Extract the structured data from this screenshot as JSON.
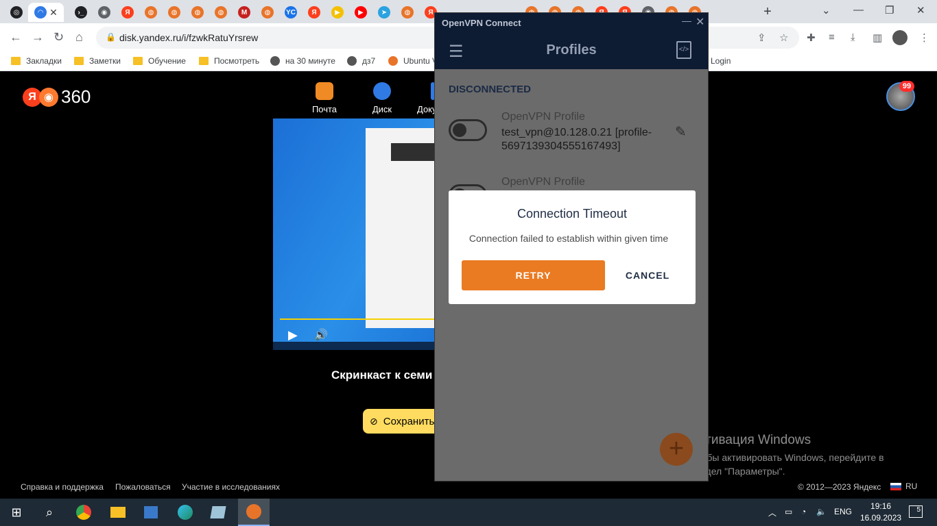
{
  "browser": {
    "tabs": [
      {
        "name": "openai-tab",
        "color": "#202124",
        "glyph": "◎"
      },
      {
        "name": "yandex-disk-tab",
        "color": "#2f7ae5",
        "glyph": "◠",
        "active": true
      },
      {
        "name": "terminal-tab",
        "color": "#202124",
        "glyph": "›_"
      },
      {
        "name": "globe-tab",
        "color": "#5f6368",
        "glyph": "◉"
      },
      {
        "name": "yandex-tab",
        "color": "#fc3f1d",
        "glyph": "Я"
      },
      {
        "name": "openvpn-tab",
        "color": "#e8742a",
        "glyph": "◍"
      },
      {
        "name": "openvpn-tab",
        "color": "#e8742a",
        "glyph": "◍"
      },
      {
        "name": "openvpn-tab",
        "color": "#e8742a",
        "glyph": "◍"
      },
      {
        "name": "openvpn-tab",
        "color": "#e8742a",
        "glyph": "◍"
      },
      {
        "name": "gmail-tab",
        "color": "#c5221f",
        "glyph": "M"
      },
      {
        "name": "openvpn-tab",
        "color": "#e8742a",
        "glyph": "◍"
      },
      {
        "name": "yc-tab",
        "color": "#1a73e8",
        "glyph": "YC"
      },
      {
        "name": "yandex-tab",
        "color": "#fc3f1d",
        "glyph": "Я"
      },
      {
        "name": "yandex-music-tab",
        "color": "#f5c000",
        "glyph": "▶"
      },
      {
        "name": "youtube-tab",
        "color": "#ff0000",
        "glyph": "▶"
      },
      {
        "name": "telegram-tab",
        "color": "#2aa3e0",
        "glyph": "➤"
      },
      {
        "name": "openvpn-tab",
        "color": "#e8742a",
        "glyph": "◍"
      },
      {
        "name": "yandex-tab",
        "color": "#fc3f1d",
        "glyph": "Я"
      }
    ],
    "right_tabs": [
      {
        "name": "openvpn-tab",
        "color": "#e8742a",
        "glyph": "◍"
      },
      {
        "name": "openvpn-tab",
        "color": "#e8742a",
        "glyph": "◍"
      },
      {
        "name": "openvpn-tab",
        "color": "#e8742a",
        "glyph": "◍"
      },
      {
        "name": "yandex-tab",
        "color": "#fc3f1d",
        "glyph": "Я"
      },
      {
        "name": "yandex-tab",
        "color": "#fc3f1d",
        "glyph": "Я"
      },
      {
        "name": "globe-tab",
        "color": "#5f6368",
        "glyph": "◉"
      },
      {
        "name": "openvpn-tab",
        "color": "#e8742a",
        "glyph": "◍"
      },
      {
        "name": "openvpn-tab",
        "color": "#e8742a",
        "glyph": "◍"
      }
    ],
    "new_tab_label": "+",
    "url": "disk.yandex.ru/i/fzwkRatuYrsrew",
    "bookmarks": [
      {
        "label": "Закладки",
        "icon": "folder"
      },
      {
        "label": "Заметки",
        "icon": "folder"
      },
      {
        "label": "Обучение",
        "icon": "folder"
      },
      {
        "label": "Посмотреть",
        "icon": "folder"
      },
      {
        "label": "на 30 минуте",
        "icon": "globe"
      },
      {
        "label": "дз7",
        "icon": "openai"
      },
      {
        "label": "Ubuntu V",
        "icon": "ovpn"
      }
    ],
    "bookmark_right": "Login"
  },
  "yandex": {
    "logo_letter": "Я",
    "logo_number": "360",
    "services": [
      {
        "label": "Почта",
        "color": "#f08a24"
      },
      {
        "label": "Диск",
        "color": "#2f7ae5"
      },
      {
        "label": "Доку",
        "color": "#2f7ae5"
      }
    ],
    "avatar_badge": "99",
    "video_title": "Скринкаст к семи",
    "save_label": "Сохранить",
    "footer": {
      "links": [
        "Справка и поддержка",
        "Пожаловаться",
        "Участие в исследованиях"
      ],
      "copyright": "© 2012—2023 Яндекс",
      "language": "RU"
    }
  },
  "activation": {
    "title": "Активация Windows",
    "text": "Чтобы активировать Windows, перейдите в раздел \"Параметры\"."
  },
  "openvpn": {
    "window_title": "OpenVPN Connect",
    "header_title": "Profiles",
    "status": "DISCONNECTED",
    "profiles": [
      {
        "name": "OpenVPN Profile",
        "description": "test_vpn@10.128.0.21 [profile-5697139304555167493]"
      },
      {
        "name": "OpenVPN Profile",
        "description": ""
      }
    ],
    "dialog": {
      "title": "Connection Timeout",
      "message": "Connection failed to establish within given time",
      "retry_label": "RETRY",
      "cancel_label": "CANCEL"
    },
    "add_button": "+"
  },
  "taskbar": {
    "language": "ENG",
    "time": "19:16",
    "date": "16.09.2023",
    "notifications": "5"
  }
}
